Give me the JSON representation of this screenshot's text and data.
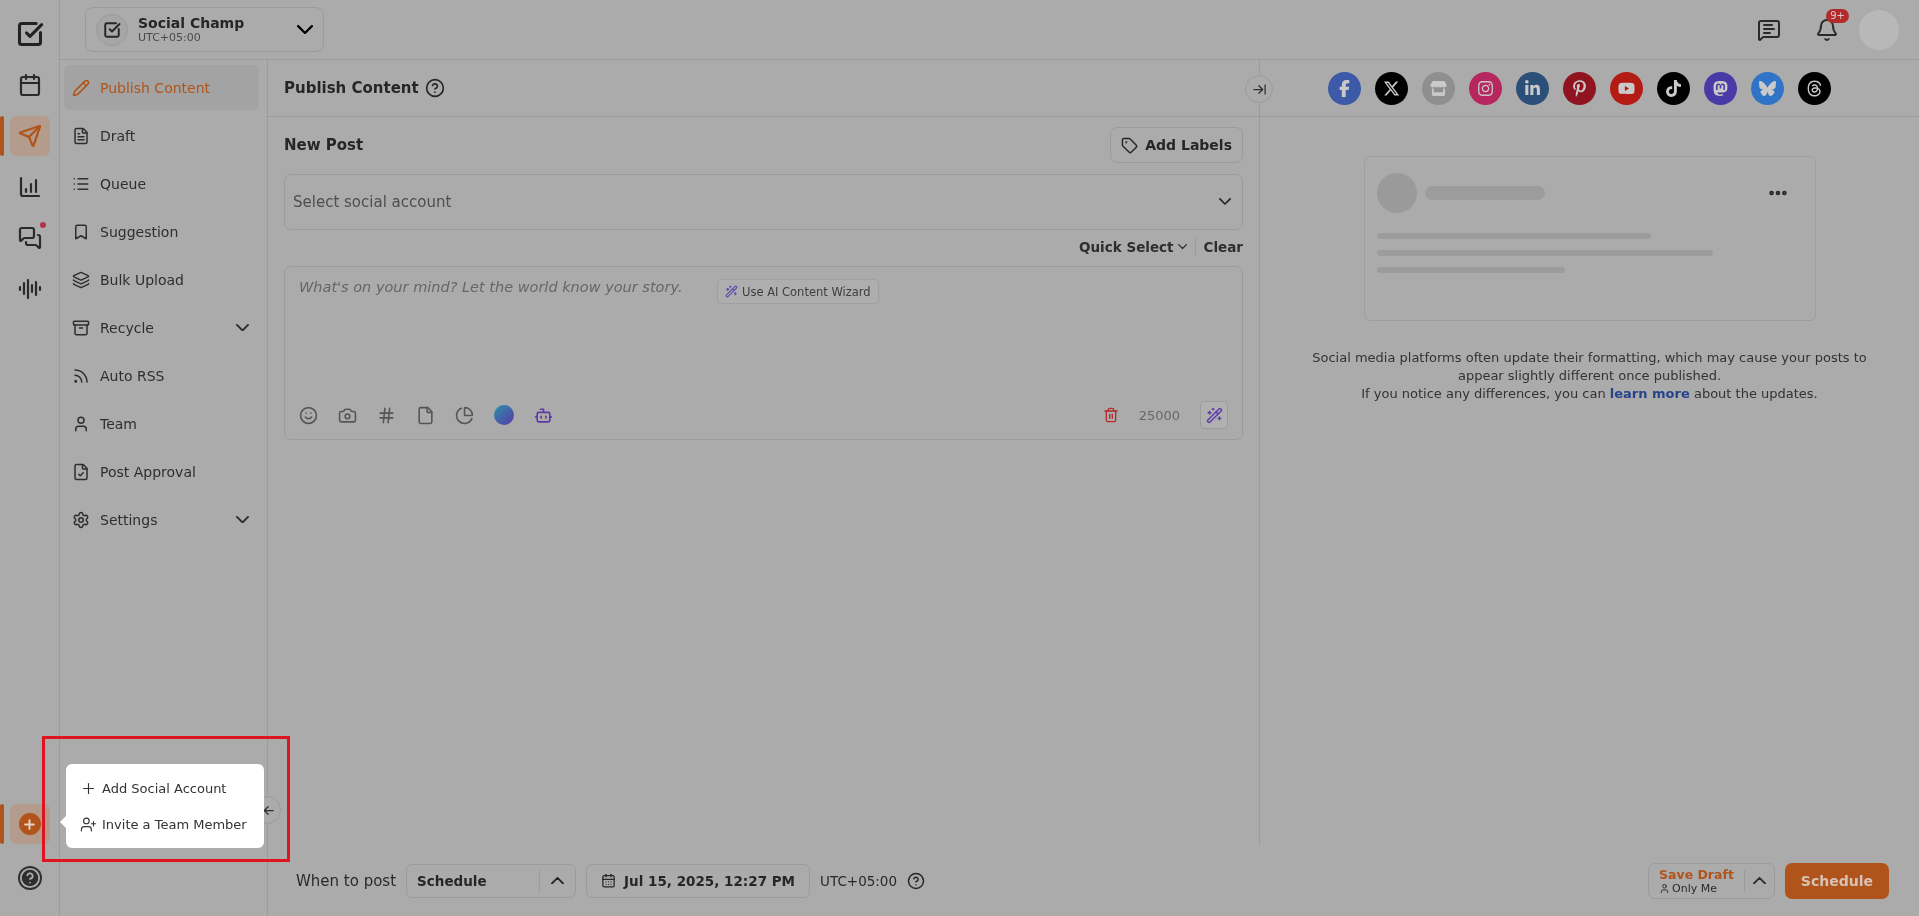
{
  "rail": {
    "items": [
      {
        "kind": "calendar",
        "selected": false,
        "unread": false
      },
      {
        "kind": "publish",
        "selected": true,
        "unread": false
      },
      {
        "kind": "analytics",
        "selected": false,
        "unread": false
      },
      {
        "kind": "inbox",
        "selected": false,
        "unread": true
      },
      {
        "kind": "listening",
        "selected": false,
        "unread": false
      }
    ],
    "add_selected": true
  },
  "workspace": {
    "name": "Social Champ",
    "timezone": "UTC+05:00"
  },
  "header": {
    "notifications": "9+"
  },
  "sidebar": {
    "items": [
      {
        "kind": "publish",
        "label": "Publish Content",
        "selected": true,
        "expandable": false
      },
      {
        "kind": "draft",
        "label": "Draft",
        "selected": false,
        "expandable": false
      },
      {
        "kind": "queue",
        "label": "Queue",
        "selected": false,
        "expandable": false
      },
      {
        "kind": "suggestion",
        "label": "Suggestion",
        "selected": false,
        "expandable": false
      },
      {
        "kind": "bulk",
        "label": "Bulk Upload",
        "selected": false,
        "expandable": false
      },
      {
        "kind": "recycle",
        "label": "Recycle",
        "selected": false,
        "expandable": true
      },
      {
        "kind": "rss",
        "label": "Auto RSS",
        "selected": false,
        "expandable": false
      },
      {
        "kind": "team",
        "label": "Team",
        "selected": false,
        "expandable": false
      },
      {
        "kind": "approval",
        "label": "Post Approval",
        "selected": false,
        "expandable": false
      },
      {
        "kind": "settings",
        "label": "Settings",
        "selected": false,
        "expandable": true
      }
    ]
  },
  "main": {
    "title": "Publish Content",
    "new_post": "New Post",
    "add_labels": "Add Labels",
    "account_select": {
      "placeholder": "Select social account"
    },
    "quick_select": "Quick Select",
    "clear": "Clear",
    "editor": {
      "placeholder": "What's on your mind? Let the world know your story.",
      "ai_button": "Use AI Content Wizard",
      "char_count": "25000",
      "tools": [
        {
          "kind": "emoji"
        },
        {
          "kind": "camera"
        },
        {
          "kind": "hashtag"
        },
        {
          "kind": "document"
        },
        {
          "kind": "chart"
        },
        {
          "kind": "canva"
        },
        {
          "kind": "bot"
        }
      ]
    }
  },
  "networks": [
    {
      "kind": "facebook",
      "color": "#3c5aa8"
    },
    {
      "kind": "x",
      "color": "#000000"
    },
    {
      "kind": "google",
      "color": "#8f8f8f"
    },
    {
      "kind": "instagram",
      "color": "#b8265f"
    },
    {
      "kind": "linkedin",
      "color": "#2b4f78"
    },
    {
      "kind": "pinterest",
      "color": "#8f1420"
    },
    {
      "kind": "youtube",
      "color": "#b41b14"
    },
    {
      "kind": "tiktok",
      "color": "#000000"
    },
    {
      "kind": "mastodon",
      "color": "#4a3aa8"
    },
    {
      "kind": "bluesky",
      "color": "#2f74c6"
    },
    {
      "kind": "threads",
      "color": "#000000"
    }
  ],
  "preview": {
    "notice_before": "Social media platforms often update their formatting, which may cause your posts to appear slightly different once published.",
    "notice_second": "If you notice any differences, you can",
    "link": "learn more",
    "notice_after": "about the updates."
  },
  "popover": {
    "items": [
      {
        "kind": "add",
        "label": "Add Social Account"
      },
      {
        "kind": "invite",
        "label": "Invite a Team Member"
      }
    ]
  },
  "footer": {
    "label": "When to post",
    "mode": "Schedule",
    "date": "Jul 15, 2025, 12:27 PM",
    "timezone": "UTC+05:00",
    "save_draft": "Save Draft",
    "visibility": "Only Me",
    "submit": "Schedule"
  }
}
